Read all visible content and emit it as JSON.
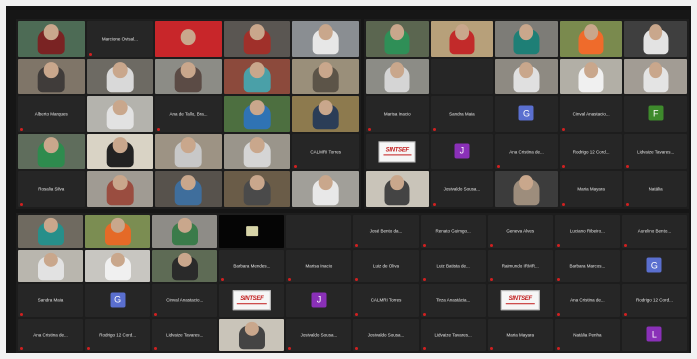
{
  "panels": {
    "p1": {
      "tiles": [
        {
          "kind": "video",
          "bg": "#4d6b55",
          "shirt": "#7a2323",
          "caption": ""
        },
        {
          "kind": "name",
          "text": "Marcione Ovisal..."
        },
        {
          "kind": "banner",
          "bg": "#c8262a",
          "shirt": "#c8262a",
          "caption": ""
        },
        {
          "kind": "video",
          "bg": "#5a5652",
          "shirt": "#a0302a",
          "caption": ""
        },
        {
          "kind": "video",
          "bg": "#8a8e92",
          "shirt": "#e7e7e7",
          "caption": ""
        },
        {
          "kind": "video",
          "bg": "#7f7568",
          "shirt": "#403c3a",
          "caption": ""
        },
        {
          "kind": "video",
          "bg": "#6d6a63",
          "shirt": "#d9d9d9",
          "caption": ""
        },
        {
          "kind": "video",
          "bg": "#8c8c86",
          "shirt": "#5b4b45",
          "caption": ""
        },
        {
          "kind": "video",
          "bg": "#8c4a3c",
          "shirt": "#4aa0a8",
          "caption": ""
        },
        {
          "kind": "video",
          "bg": "#9a8f7a",
          "shirt": "#5c5448",
          "caption": ""
        },
        {
          "kind": "name",
          "text": "Alberto Marques"
        },
        {
          "kind": "video",
          "bg": "#b4b3ad",
          "shirt": "#e2e2e2",
          "caption": ""
        },
        {
          "kind": "name",
          "text": "Ana de Tallo, Bra..."
        },
        {
          "kind": "video",
          "bg": "#4d6f40",
          "shirt": "#2f73b4",
          "caption": ""
        },
        {
          "kind": "video",
          "bg": "#8d7a4e",
          "shirt": "#2b3d57",
          "caption": ""
        },
        {
          "kind": "video",
          "bg": "#5f6d5c",
          "shirt": "#2e8b4e",
          "caption": ""
        },
        {
          "kind": "video",
          "bg": "#d9d3c5",
          "shirt": "#222222",
          "caption": ""
        },
        {
          "kind": "video",
          "bg": "#9d9384",
          "shirt": "#c8c8c8",
          "caption": ""
        },
        {
          "kind": "video",
          "bg": "#9a958b",
          "shirt": "#d5d5d5",
          "caption": ""
        },
        {
          "kind": "name",
          "text": "CALMRI Torres"
        },
        {
          "kind": "name",
          "text": "Rosalia Silva"
        },
        {
          "kind": "video",
          "bg": "#a09b93",
          "shirt": "#9a4d40",
          "caption": ""
        },
        {
          "kind": "video",
          "bg": "#57524c",
          "shirt": "#3f6e9c",
          "caption": ""
        },
        {
          "kind": "video",
          "bg": "#6a5c48",
          "shirt": "#4a4a4a",
          "caption": ""
        },
        {
          "kind": "video",
          "bg": "#a19f99",
          "shirt": "#e8e8e8",
          "caption": ""
        }
      ]
    },
    "p2": {
      "tiles": [
        {
          "kind": "video",
          "bg": "#5b6650",
          "shirt": "#2f8f57",
          "caption": ""
        },
        {
          "kind": "video",
          "bg": "#b7a07a",
          "shirt": "#c22a2a",
          "caption": ""
        },
        {
          "kind": "video",
          "bg": "#7d7c77",
          "shirt": "#1e7f76",
          "caption": ""
        },
        {
          "kind": "video",
          "bg": "#7a8a4e",
          "shirt": "#ef6b2b",
          "caption": ""
        },
        {
          "kind": "video",
          "bg": "#3f3f3f",
          "shirt": "#e3e3e3",
          "caption": ""
        },
        {
          "kind": "video",
          "bg": "#8c8c86",
          "shirt": "#d5d5d5",
          "caption": ""
        },
        {
          "kind": "blank"
        },
        {
          "kind": "video",
          "bg": "#8e8a82",
          "shirt": "#e0e0e0",
          "caption": ""
        },
        {
          "kind": "video",
          "bg": "#b2afa6",
          "shirt": "#f0f0f0",
          "caption": ""
        },
        {
          "kind": "video",
          "bg": "#a29c94",
          "shirt": "#e4e4e4",
          "caption": ""
        },
        {
          "kind": "name",
          "text": "Marisa Inacio"
        },
        {
          "kind": "name",
          "text": "Sandra Maia"
        },
        {
          "kind": "initial",
          "letter": "G",
          "color": "#5a6fcf"
        },
        {
          "kind": "name",
          "text": "Cinval Anastacio..."
        },
        {
          "kind": "initial",
          "letter": "F",
          "color": "#3e8a2c"
        },
        {
          "kind": "logo",
          "logo": "SINTSEF"
        },
        {
          "kind": "initial",
          "letter": "J",
          "color": "#8a30b8"
        },
        {
          "kind": "name",
          "text": "Ana Cristina de..."
        },
        {
          "kind": "name",
          "text": "Rodrigo 12 Cord..."
        },
        {
          "kind": "name",
          "text": "Lidvaize Tavares..."
        },
        {
          "kind": "video",
          "bg": "#c9c4b9",
          "shirt": "#444444",
          "caption": ""
        },
        {
          "kind": "name",
          "text": "Josivaldo Sousa..."
        },
        {
          "kind": "video",
          "bg": "#3c3c3c",
          "shirt": "#9d8d7c",
          "caption": ""
        },
        {
          "kind": "name",
          "text": "Maria Mayara"
        },
        {
          "kind": "name",
          "text": "Natália"
        }
      ]
    },
    "p3": {
      "tiles": [
        {
          "kind": "video",
          "bg": "#6f6a60",
          "shirt": "#278f8a",
          "caption": ""
        },
        {
          "kind": "video",
          "bg": "#7b8d52",
          "shirt": "#e56a27",
          "caption": ""
        },
        {
          "kind": "video",
          "bg": "#8e8c87",
          "shirt": "#3b7b4a",
          "caption": ""
        },
        {
          "kind": "sign"
        },
        {
          "kind": "blank"
        },
        {
          "kind": "name",
          "text": "José Bento da..."
        },
        {
          "kind": "name",
          "text": "Renato Guimgo..."
        },
        {
          "kind": "name",
          "text": "Geneva Alves"
        },
        {
          "kind": "name",
          "text": "Luciano Ribeiro..."
        },
        {
          "kind": "name",
          "text": "Aurelino Bento..."
        },
        {
          "kind": "video",
          "bg": "#b9b6ae",
          "shirt": "#e2e2e2",
          "caption": ""
        },
        {
          "kind": "video",
          "bg": "#c8c6c1",
          "shirt": "#f0f0f0",
          "caption": ""
        },
        {
          "kind": "video",
          "bg": "#5e6b55",
          "shirt": "#2a2a2a",
          "caption": ""
        },
        {
          "kind": "name",
          "text": "Barbara Mendes..."
        },
        {
          "kind": "name",
          "text": "Marisa Inacio"
        },
        {
          "kind": "name",
          "text": "Luiz de Oliva"
        },
        {
          "kind": "name",
          "text": "Luiz Batista de..."
        },
        {
          "kind": "name",
          "text": "Raimundo IRMR..."
        },
        {
          "kind": "name",
          "text": "Barbara Marcos..."
        },
        {
          "kind": "initial",
          "letter": "G",
          "color": "#5a6fcf"
        },
        {
          "kind": "name",
          "text": "Sandra Maia"
        },
        {
          "kind": "initial",
          "letter": "G",
          "color": "#5a6fcf"
        },
        {
          "kind": "name",
          "text": "Cinval Anastacio..."
        },
        {
          "kind": "logo",
          "logo": "SINTSEF"
        },
        {
          "kind": "initial",
          "letter": "J",
          "color": "#8a30b8"
        },
        {
          "kind": "name",
          "text": "CALMRI Torres"
        },
        {
          "kind": "name",
          "text": "Tirza Anastácia..."
        },
        {
          "kind": "logo",
          "logo": "SINTSEF"
        },
        {
          "kind": "name",
          "text": "Ana Cristina de..."
        },
        {
          "kind": "name",
          "text": "Rodrigo 12 Cord..."
        },
        {
          "kind": "name",
          "text": "Ana Cristina de..."
        },
        {
          "kind": "name",
          "text": "Rodrigo 12 Cord..."
        },
        {
          "kind": "name",
          "text": "Lidvaize Tavares..."
        },
        {
          "kind": "video",
          "bg": "#c9c4b9",
          "shirt": "#444444",
          "caption": ""
        },
        {
          "kind": "name",
          "text": "Josivaldo Sousa..."
        },
        {
          "kind": "name",
          "text": "Josivaldo Sousa..."
        },
        {
          "kind": "name",
          "text": "Lidvaize Tavares..."
        },
        {
          "kind": "name",
          "text": "Maria Mayara"
        },
        {
          "kind": "name",
          "text": "Natália Penha"
        },
        {
          "kind": "initial",
          "letter": "L",
          "color": "#8a30b8"
        }
      ]
    }
  }
}
